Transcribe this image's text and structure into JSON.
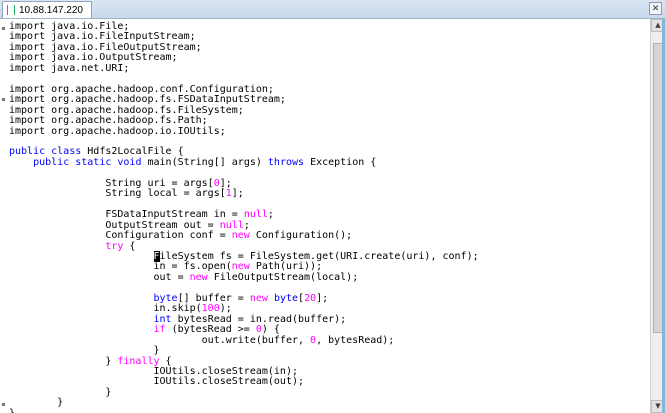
{
  "tab": {
    "title": "10.88.147.220",
    "close_glyph": "✕"
  },
  "editor": {
    "lines": [
      [
        {
          "t": "import java.io.File;"
        }
      ],
      [
        {
          "t": "import java.io.FileInputStream;"
        }
      ],
      [
        {
          "t": "import java.io.FileOutputStream;"
        }
      ],
      [
        {
          "t": "import java.io.OutputStream;"
        }
      ],
      [
        {
          "t": "import java.net.URI;"
        }
      ],
      [
        {
          "t": ""
        }
      ],
      [
        {
          "t": "import org.apache.hadoop.conf.Configuration;"
        }
      ],
      [
        {
          "t": "import org.apache.hadoop.fs.FSDataInputStream;"
        }
      ],
      [
        {
          "t": "import org.apache.hadoop.fs.FileSystem;"
        }
      ],
      [
        {
          "t": "import org.apache.hadoop.fs.Path;"
        }
      ],
      [
        {
          "t": "import org.apache.hadoop.io.IOUtils;"
        }
      ],
      [
        {
          "t": ""
        }
      ],
      [
        {
          "t": "public class ",
          "c": "k"
        },
        {
          "t": "Hdfs2LocalFile {"
        }
      ],
      [
        {
          "t": "    "
        },
        {
          "t": "public static void ",
          "c": "k"
        },
        {
          "t": "main(String[] args) "
        },
        {
          "t": "throws ",
          "c": "k"
        },
        {
          "t": "Exception {"
        }
      ],
      [
        {
          "t": ""
        }
      ],
      [
        {
          "t": "                String uri = args["
        },
        {
          "t": "0",
          "c": "s"
        },
        {
          "t": "];"
        }
      ],
      [
        {
          "t": "                String local = args["
        },
        {
          "t": "1",
          "c": "s"
        },
        {
          "t": "];"
        }
      ],
      [
        {
          "t": ""
        }
      ],
      [
        {
          "t": "                FSDataInputStream in = "
        },
        {
          "t": "null",
          "c": "s"
        },
        {
          "t": ";"
        }
      ],
      [
        {
          "t": "                OutputStream out = "
        },
        {
          "t": "null",
          "c": "s"
        },
        {
          "t": ";"
        }
      ],
      [
        {
          "t": "                Configuration conf = "
        },
        {
          "t": "new ",
          "c": "s"
        },
        {
          "t": "Configuration();"
        }
      ],
      [
        {
          "t": "                "
        },
        {
          "t": "try ",
          "c": "s"
        },
        {
          "t": "{"
        }
      ],
      [
        {
          "t": "                        "
        },
        {
          "t": "F",
          "c": "cursor"
        },
        {
          "t": "ileSystem fs = FileSystem.get(URI.create(uri), conf);"
        }
      ],
      [
        {
          "t": "                        in = fs.open("
        },
        {
          "t": "new ",
          "c": "s"
        },
        {
          "t": "Path(uri));"
        }
      ],
      [
        {
          "t": "                        out = "
        },
        {
          "t": "new ",
          "c": "s"
        },
        {
          "t": "FileOutputStream(local);"
        }
      ],
      [
        {
          "t": ""
        }
      ],
      [
        {
          "t": "                        "
        },
        {
          "t": "byte",
          "c": "k"
        },
        {
          "t": "[] buffer = "
        },
        {
          "t": "new ",
          "c": "s"
        },
        {
          "t": "byte",
          "c": "k"
        },
        {
          "t": "["
        },
        {
          "t": "20",
          "c": "s"
        },
        {
          "t": "];"
        }
      ],
      [
        {
          "t": "                        in.skip("
        },
        {
          "t": "100",
          "c": "s"
        },
        {
          "t": ");"
        }
      ],
      [
        {
          "t": "                        "
        },
        {
          "t": "int ",
          "c": "k"
        },
        {
          "t": "bytesRead = in.read(buffer);"
        }
      ],
      [
        {
          "t": "                        "
        },
        {
          "t": "if ",
          "c": "s"
        },
        {
          "t": "(bytesRead >= "
        },
        {
          "t": "0",
          "c": "s"
        },
        {
          "t": ") {"
        }
      ],
      [
        {
          "t": "                                out.write(buffer, "
        },
        {
          "t": "0",
          "c": "s"
        },
        {
          "t": ", bytesRead);"
        }
      ],
      [
        {
          "t": "                        }"
        }
      ],
      [
        {
          "t": "                } "
        },
        {
          "t": "finally ",
          "c": "s"
        },
        {
          "t": "{"
        }
      ],
      [
        {
          "t": "                        IOUtils.closeStream(in);"
        }
      ],
      [
        {
          "t": "                        IOUtils.closeStream(out);"
        }
      ],
      [
        {
          "t": "                }"
        }
      ],
      [
        {
          "t": "        }"
        }
      ],
      [
        {
          "t": "}"
        }
      ]
    ]
  },
  "scrollbar": {
    "up_glyph": "▲",
    "down_glyph": "▼"
  }
}
